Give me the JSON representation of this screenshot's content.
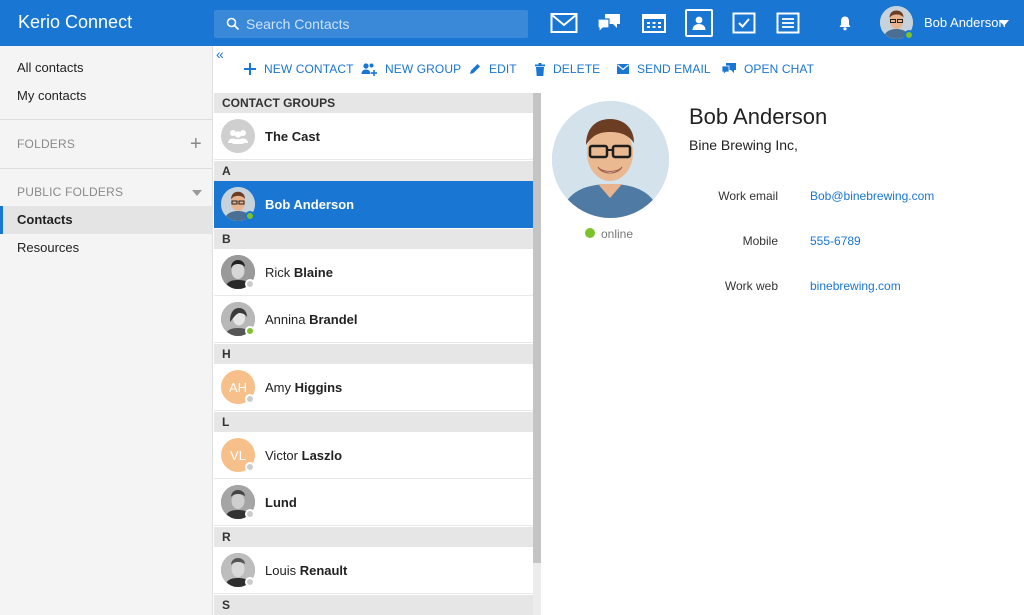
{
  "app": {
    "title": "Kerio Connect"
  },
  "search": {
    "placeholder": "Search Contacts"
  },
  "topnav": {
    "apps": [
      {
        "icon": "mail-icon"
      },
      {
        "icon": "chat-icon"
      },
      {
        "icon": "calendar-icon"
      },
      {
        "icon": "contacts-icon",
        "active": true
      },
      {
        "icon": "tasks-icon"
      },
      {
        "icon": "notes-icon"
      }
    ],
    "user_name": "Bob Anderson"
  },
  "sidebar": {
    "all_contacts": "All contacts",
    "my_contacts": "My contacts",
    "folders_heading": "FOLDERS",
    "add_symbol": "+",
    "public_heading": "PUBLIC FOLDERS",
    "contacts": "Contacts",
    "resources": "Resources"
  },
  "toolbar": {
    "collapse": "«",
    "new_contact": "NEW CONTACT",
    "new_group": "NEW GROUP",
    "edit": "EDIT",
    "delete": "DELETE",
    "send_email": "SEND EMAIL",
    "open_chat": "OPEN CHAT"
  },
  "list": {
    "groups_heading": "CONTACT GROUPS",
    "group_name": "The Cast",
    "sections": [
      "A",
      "B",
      "H",
      "L",
      "R",
      "S"
    ],
    "contacts": [
      {
        "first": "Bob",
        "last": "Anderson",
        "status": "online"
      },
      {
        "first": "Rick",
        "last": "Blaine",
        "status": "offline"
      },
      {
        "first": "Annina",
        "last": "Brandel",
        "status": "online"
      },
      {
        "first": "Amy",
        "last": "Higgins",
        "initials": "AH",
        "status": "offline"
      },
      {
        "first": "Victor",
        "last": "Laszlo",
        "initials": "VL",
        "status": "offline"
      },
      {
        "first": "",
        "last": "Lund",
        "status": "offline"
      },
      {
        "first": "Louis",
        "last": "Renault",
        "status": "offline"
      }
    ]
  },
  "detail": {
    "name": "Bob Anderson",
    "company": "Bine Brewing Inc,",
    "status": "online",
    "fields": [
      {
        "label": "Work email",
        "value": "Bob@binebrewing.com"
      },
      {
        "label": "Mobile",
        "value": "555-6789"
      },
      {
        "label": "Work web",
        "value": "binebrewing.com"
      }
    ]
  },
  "colors": {
    "brand": "#1976d2",
    "online": "#7cc22a",
    "offline": "#cccccc",
    "initials_bg": "#f7c08a"
  }
}
